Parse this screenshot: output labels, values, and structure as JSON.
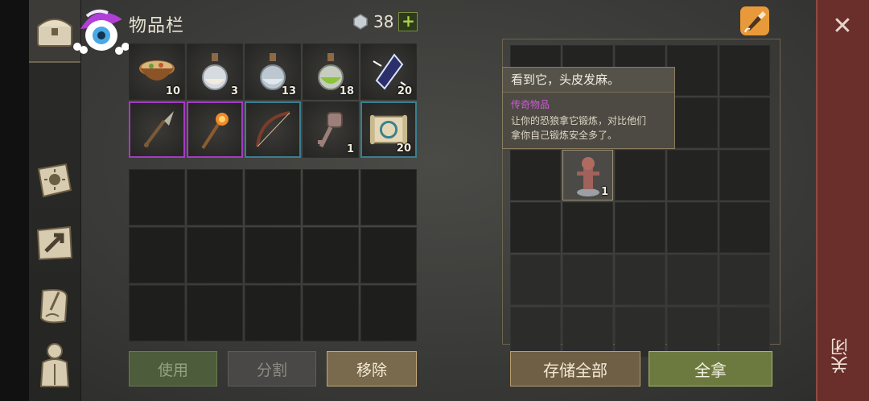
{
  "inventory": {
    "title": "物品栏",
    "gem_count": "38",
    "plus_label": "+",
    "items": [
      {
        "name": "stew-bowl",
        "qty": "10",
        "frame": ""
      },
      {
        "name": "potion-white",
        "qty": "3",
        "frame": ""
      },
      {
        "name": "potion-clear",
        "qty": "13",
        "frame": ""
      },
      {
        "name": "potion-green",
        "qty": "18",
        "frame": ""
      },
      {
        "name": "crystal-shard",
        "qty": "20",
        "frame": ""
      },
      {
        "name": "spear",
        "qty": "",
        "frame": "purple"
      },
      {
        "name": "fire-staff",
        "qty": "",
        "frame": "purple"
      },
      {
        "name": "bow",
        "qty": "",
        "frame": "teal"
      },
      {
        "name": "ornate-key",
        "qty": "1",
        "frame": ""
      },
      {
        "name": "rune-scroll",
        "qty": "20",
        "frame": "teal"
      }
    ]
  },
  "buttons": {
    "use": "使用",
    "split": "分割",
    "remove": "移除",
    "store_all": "存储全部",
    "take_all": "全拿"
  },
  "container": {
    "item_qty": "1",
    "item_name": "training-dummy"
  },
  "tooltip": {
    "header": "看到它，头皮发麻。",
    "rarity": "传奇物品",
    "desc_line1": "让你的恐狼拿它锻炼，对比他们",
    "desc_line2": "拿你自己锻炼安全多了。"
  },
  "close_label": "关闭",
  "colors": {
    "legendary": "#d05ad8",
    "accent": "#a9d24a",
    "close_bg": "#6a2f2a"
  }
}
